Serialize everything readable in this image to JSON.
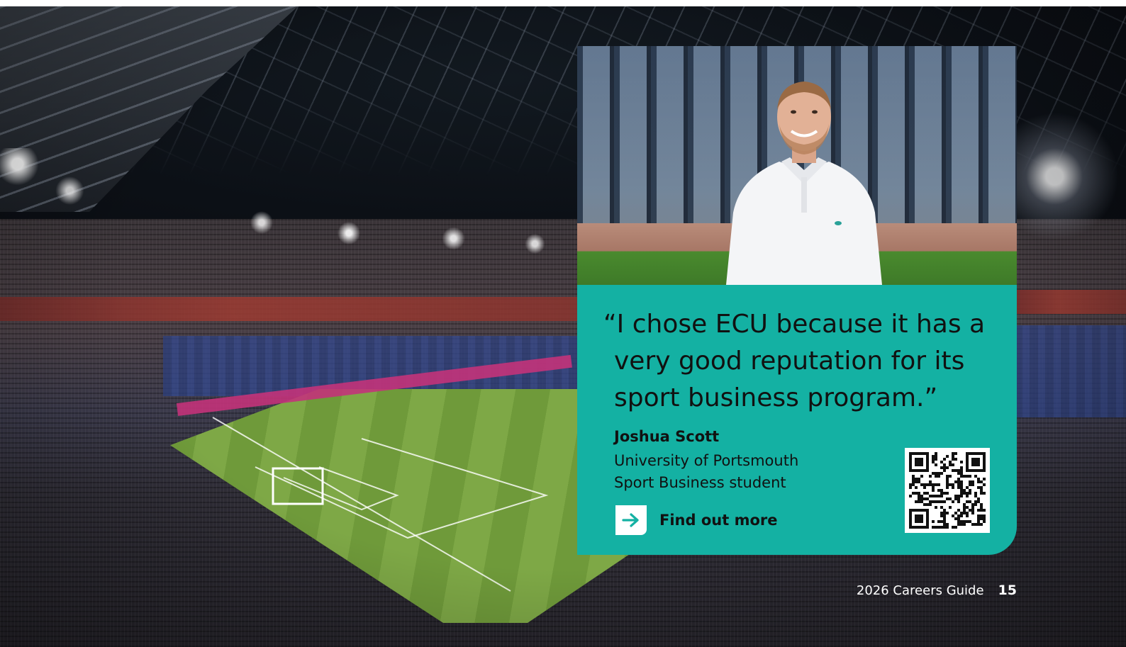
{
  "quote": {
    "text": "“I chose ECU because it has a very good reputation for its sport business program.”"
  },
  "student": {
    "name": "Joshua Scott",
    "university": "University of Portsmouth",
    "course": "Sport Business student"
  },
  "cta": {
    "label": "Find out more",
    "icon": "arrow-right-icon"
  },
  "footer": {
    "guide": "2026 Careers Guide",
    "page_number": "15"
  },
  "colors": {
    "panel": "#14b1a3",
    "text": "#111111",
    "footer_text": "#ffffff"
  }
}
